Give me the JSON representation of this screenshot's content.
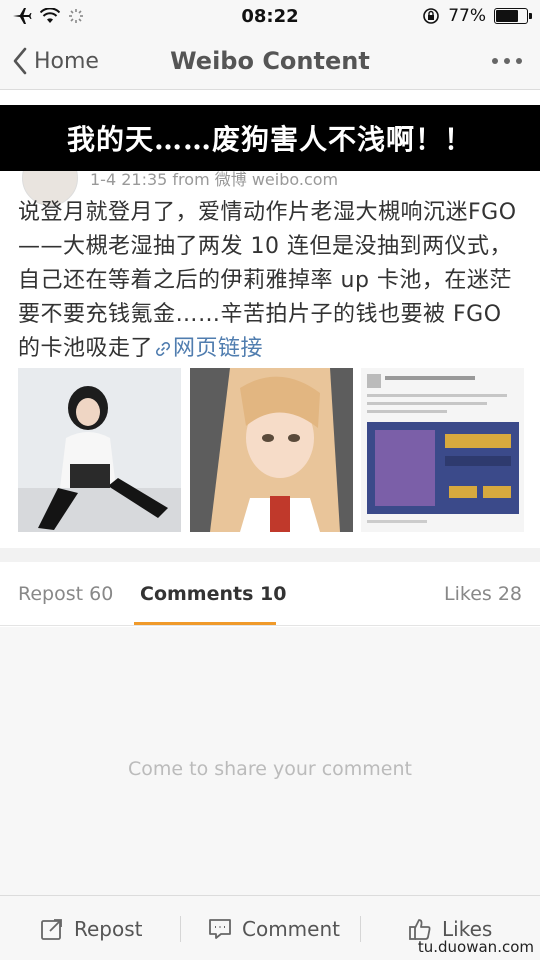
{
  "status_bar": {
    "time": "08:22",
    "battery_percent": "77%",
    "battery_level": 0.77
  },
  "nav": {
    "back_label": "Home",
    "title": "Weibo Content"
  },
  "post": {
    "meta_text": "1-4 21:35  from 微博 weibo.com",
    "body": "说登月就登月了，爱情动作片老湿大槻响沉迷FGO——大槻老湿抽了两发 10 连但是没抽到两仪式，自己还在等着之后的伊莉雅掉率 up 卡池，在迷茫要不要充钱氪金……辛苦拍片子的钱也要被 FGO 的卡池吸走了",
    "link_text": "网页链接"
  },
  "overlay_caption": "我的天……废狗害人不浅啊！！",
  "tabs": {
    "repost": "Repost 60",
    "comments": "Comments 10",
    "likes": "Likes 28"
  },
  "comments": {
    "empty_text": "Come to share your comment"
  },
  "toolbar": {
    "repost": "Repost",
    "comment": "Comment",
    "likes": "Likes"
  },
  "watermark": "tu.duowan.com",
  "colors": {
    "accent_underline": "#f09a2a",
    "link": "#507daf"
  }
}
